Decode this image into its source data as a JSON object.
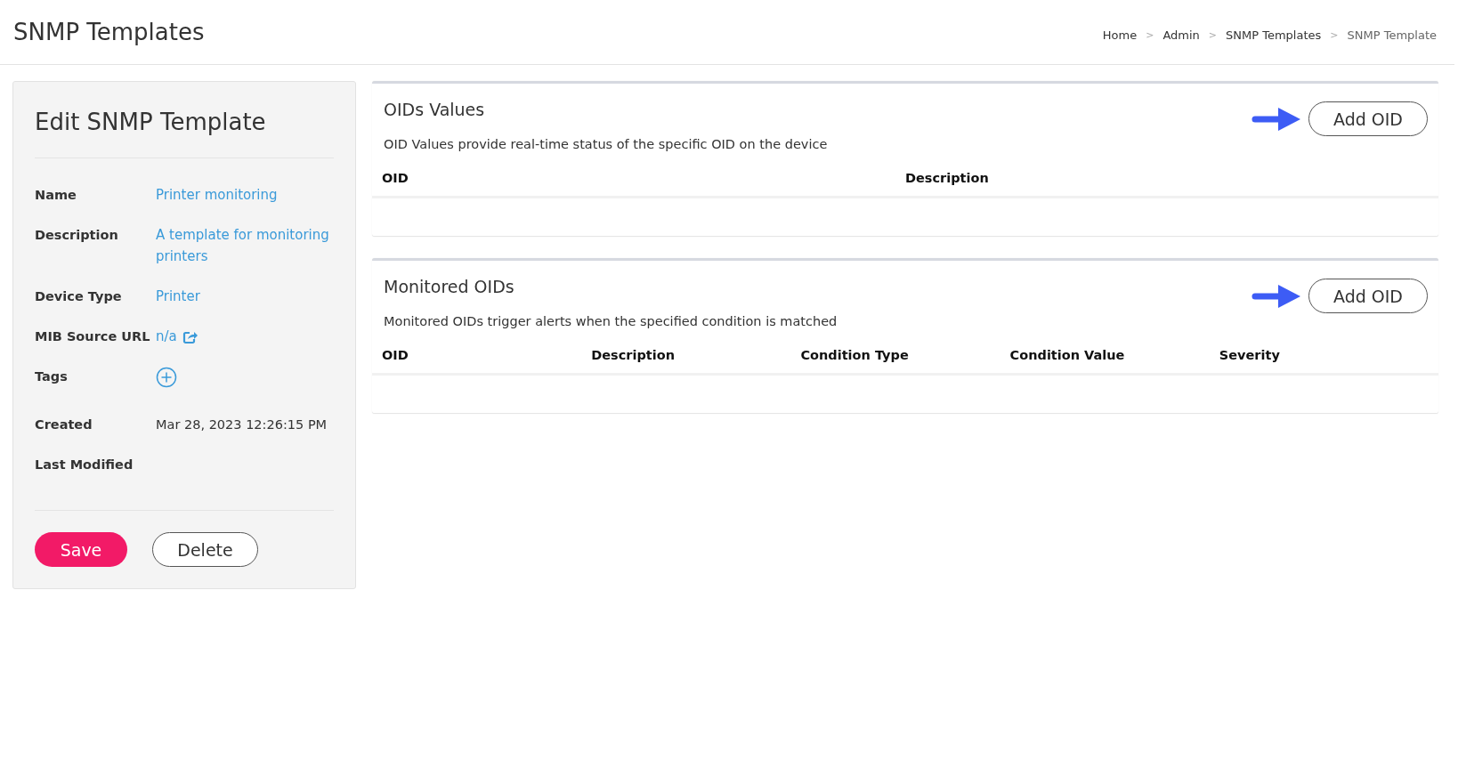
{
  "page_title": "SNMP Templates",
  "breadcrumb": [
    {
      "label": "Home",
      "current": false
    },
    {
      "label": "Admin",
      "current": false
    },
    {
      "label": "SNMP Templates",
      "current": false
    },
    {
      "label": "SNMP Template",
      "current": true
    }
  ],
  "breadcrumb_separator": ">",
  "edit_card": {
    "title": "Edit SNMP Template",
    "fields": [
      {
        "label": "Name",
        "kind": "link",
        "value": "Printer monitoring"
      },
      {
        "label": "Description",
        "kind": "link",
        "value": "A template for monitoring printers"
      },
      {
        "label": "Device Type",
        "kind": "link",
        "value": "Printer"
      },
      {
        "label": "MIB Source URL",
        "kind": "url",
        "value": "n/a"
      },
      {
        "label": "Tags",
        "kind": "tags"
      },
      {
        "label": "Created",
        "kind": "text",
        "value": "Mar 28, 2023 12:26:15 PM"
      },
      {
        "label": "Last Modified",
        "kind": "text"
      }
    ],
    "buttons": [
      {
        "label": "Save",
        "kind": "primary"
      },
      {
        "label": "Delete",
        "kind": "secondary"
      }
    ]
  },
  "panels": [
    {
      "title": "OIDs Values",
      "button": "Add OID",
      "highlighted": true,
      "description": "OID Values provide real-time status of the specific OID on the device",
      "columns": [
        "OID",
        "Description"
      ]
    },
    {
      "title": "Monitored OIDs",
      "button": "Add OID",
      "highlighted": true,
      "description": "Monitored OIDs trigger alerts when the specified condition is matched",
      "columns": [
        "OID",
        "Description",
        "Condition Type",
        "Condition Value",
        "Severity"
      ]
    }
  ]
}
